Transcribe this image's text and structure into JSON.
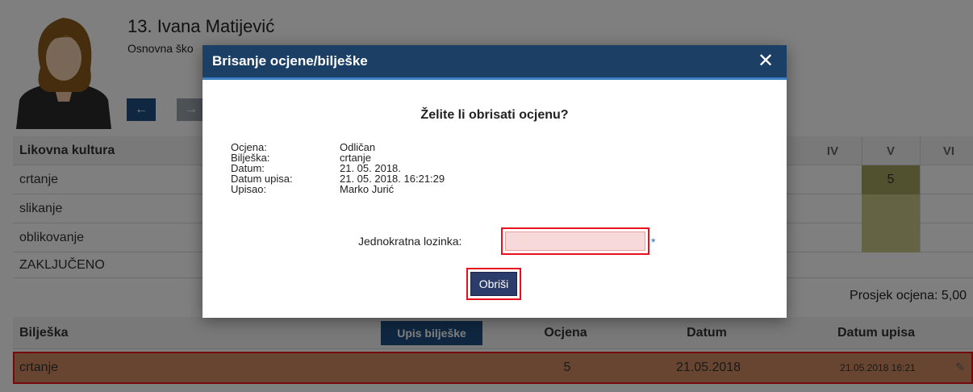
{
  "student": {
    "name": "13. Ivana Matijević",
    "school": "Osnovna ško"
  },
  "subject": {
    "title": "Likovna kultura",
    "columns": [
      "IV",
      "V",
      "VI"
    ],
    "rows": [
      {
        "label": "crtanje",
        "grade_v": "5"
      },
      {
        "label": "slikanje",
        "grade_v": ""
      },
      {
        "label": "oblikovanje",
        "grade_v": ""
      }
    ],
    "concluded_label": "ZAKLJUČENO",
    "average": "Prosjek ocjena: 5,00"
  },
  "notes": {
    "headers": {
      "note": "Bilješka",
      "grade": "Ocjena",
      "date": "Datum",
      "entry_date": "Datum upisa"
    },
    "add_button": "Upis bilješke",
    "row": {
      "note": "crtanje",
      "grade": "5",
      "date": "21.05.2018",
      "entry_date": "21.05.2018 16:21"
    }
  },
  "modal": {
    "title": "Brisanje ocjene/bilješke",
    "question": "Želite li obrisati ocjenu?",
    "details": [
      {
        "key": "Ocjena:",
        "value": "Odličan"
      },
      {
        "key": "Bilješka:",
        "value": "crtanje"
      },
      {
        "key": "Datum:",
        "value": "21. 05. 2018."
      },
      {
        "key": "Datum upisa:",
        "value": "21. 05. 2018. 16:21:29"
      },
      {
        "key": "Upisao:",
        "value": "Marko Jurić"
      }
    ],
    "password_label": "Jednokratna lozinka:",
    "password_value": "",
    "required_mark": "*",
    "delete_button": "Obriši",
    "close_glyph": "✕"
  },
  "icons": {
    "prev": "arrow-left-icon",
    "next": "arrow-right-icon",
    "edit": "pencil-icon",
    "close": "close-icon"
  },
  "colors": {
    "header": "#1c3f66",
    "button": "#1f4f80",
    "highlight": "#e8101a",
    "grade_cell": "#a3a361"
  }
}
